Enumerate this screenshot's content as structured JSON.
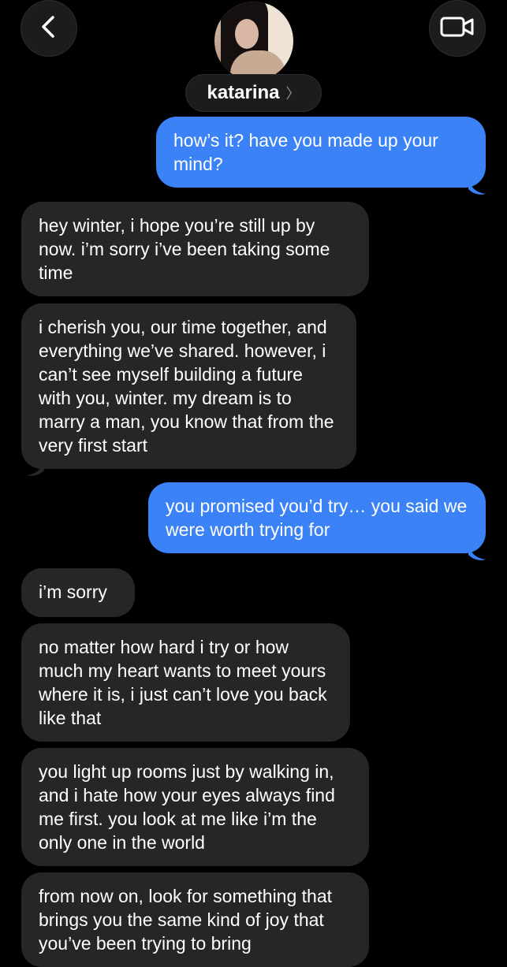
{
  "header": {
    "contact_name": "katarina",
    "name_chevron": "〉",
    "back_icon": "chevron-left-icon",
    "video_icon": "video-camera-icon"
  },
  "messages": [
    {
      "direction": "outgoing",
      "text": "how’s it? have you made up your mind?"
    },
    {
      "direction": "incoming",
      "text": "hey winter, i hope you’re still up by now. i’m sorry i’ve been taking some time"
    },
    {
      "direction": "incoming",
      "text": "i cherish you, our time together, and everything we’ve shared. however, i can’t see myself building a future with you, winter. my dream is to marry a man, you know that from the very first start"
    },
    {
      "direction": "outgoing",
      "text": "you promised you’d try… you said we were worth trying for"
    },
    {
      "direction": "incoming",
      "text": "i’m sorry"
    },
    {
      "direction": "incoming",
      "text": "no matter how hard i try or how much my heart wants to meet yours where it is, i just can’t love you back like that"
    },
    {
      "direction": "incoming",
      "text": "you light up rooms just by walking in, and i hate how your eyes always find me first. you look at me like i’m the only one in the world"
    },
    {
      "direction": "incoming",
      "text": "from now on, look for something that brings you the same kind of joy that you’ve been trying to bring"
    }
  ],
  "colors": {
    "background": "#000000",
    "incoming_bubble": "#262628",
    "outgoing_bubble": "#3b82f6",
    "header_button": "#1c1c1e"
  }
}
